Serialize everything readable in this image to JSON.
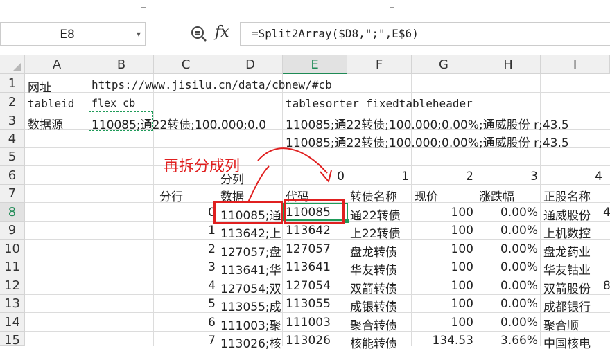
{
  "formula_bar": {
    "name_box": "E8",
    "fx_label": "fx",
    "formula": "=Split2Array($D8,\";\",E$6)"
  },
  "columns": [
    "A",
    "B",
    "C",
    "D",
    "E",
    "F",
    "G",
    "H",
    "I"
  ],
  "selected_column": "E",
  "rows": [
    "1",
    "2",
    "3",
    "4",
    "5",
    "6",
    "7",
    "8",
    "9",
    "10",
    "11",
    "12",
    "13",
    "14"
  ],
  "selected_row": "8",
  "cells": {
    "A1": "网址",
    "B1": "https://www.jisilu.cn/data/cbnew/#cb",
    "A2": "tableid",
    "B2": "flex_cb",
    "E2": "tablesorter fixedtableheader",
    "A3": "数据源",
    "B3": "110085;通22转债;100.000;0.0",
    "E3": "110085;通22转债;100.000;0.00%;通威股份 r;43.5",
    "E4": "110085;通22转债;100.000;0.00%;通威股份 r;43.5",
    "D6": "分列",
    "E6": "0",
    "F6": "1",
    "G6": "2",
    "H6": "3",
    "I6": "4",
    "C7": "分行",
    "D7": "数据",
    "E7": "代码",
    "F7": "转债名称",
    "G7": "现价",
    "H7": "涨跌幅",
    "I7": "正股名称"
  },
  "data_rows": [
    {
      "c": "0",
      "d": "110085;通",
      "e": "110085",
      "f": "通22转债",
      "g": "100",
      "h": "0.00%",
      "i": "通威股份"
    },
    {
      "c": "1",
      "d": "113642;上",
      "e": "113642",
      "f": "上22转债",
      "g": "100",
      "h": "0.00%",
      "i": "上机数控"
    },
    {
      "c": "2",
      "d": "127057;盘",
      "e": "127057",
      "f": "盘龙转债",
      "g": "100",
      "h": "0.00%",
      "i": "盘龙药业"
    },
    {
      "c": "3",
      "d": "113641;华",
      "e": "113641",
      "f": "华友转债",
      "g": "100",
      "h": "0.00%",
      "i": "华友钴业"
    },
    {
      "c": "4",
      "d": "127054;双",
      "e": "127054",
      "f": "双箭转债",
      "g": "100",
      "h": "0.00%",
      "i": "双箭股份"
    },
    {
      "c": "5",
      "d": "113055;成",
      "e": "113055",
      "f": "成银转债",
      "g": "100",
      "h": "0.00%",
      "i": "成都银行"
    },
    {
      "c": "6",
      "d": "111003;聚",
      "e": "111003",
      "f": "聚合转债",
      "g": "100",
      "h": "0.00%",
      "i": "聚合顺"
    },
    {
      "c": "7",
      "d": "113026;核",
      "e": "113026",
      "f": "核能转债",
      "g": "134.53",
      "h": "3.66%",
      "i": "中国核电"
    }
  ],
  "overflow_stubs": [
    "4",
    "8"
  ],
  "annotation": {
    "text": "再拆分成列",
    "color": "#e02020"
  },
  "colors": {
    "selection": "#1f9b59",
    "header_bg": "#f0f0f0",
    "annotation_red": "#e02020"
  }
}
